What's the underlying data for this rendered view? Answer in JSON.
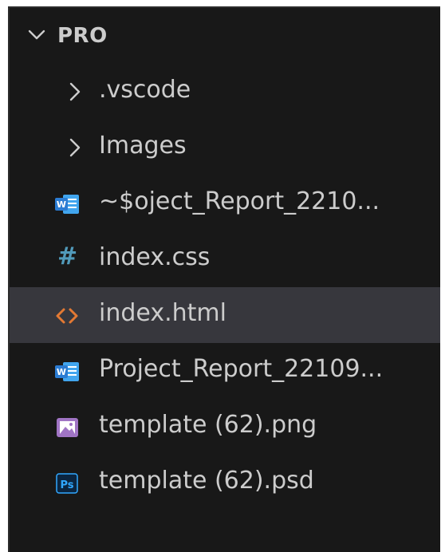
{
  "explorer": {
    "title": "PRO",
    "items": [
      {
        "label": ".vscode",
        "kind": "folder",
        "icon": "chevron-right-icon"
      },
      {
        "label": "Images",
        "kind": "folder",
        "icon": "chevron-right-icon"
      },
      {
        "label": "~$oject_Report_2210...",
        "kind": "file",
        "icon": "word-document-icon"
      },
      {
        "label": "index.css",
        "kind": "file",
        "icon": "css-hash-icon"
      },
      {
        "label": "index.html",
        "kind": "file",
        "icon": "html-code-icon",
        "selected": true
      },
      {
        "label": "Project_Report_22109...",
        "kind": "file",
        "icon": "word-document-icon"
      },
      {
        "label": "template (62).png",
        "kind": "file",
        "icon": "image-file-icon"
      },
      {
        "label": "template (62).psd",
        "kind": "file",
        "icon": "photoshop-file-icon"
      }
    ]
  },
  "colors": {
    "background": "#181818",
    "selected_row": "#37373d",
    "text": "#cccccc",
    "word_blue": "#2b7cd3",
    "css_hash": "#519aba",
    "html_orange": "#e37933",
    "image_purple": "#a074c4",
    "photoshop_blue": "#31a8ff"
  }
}
